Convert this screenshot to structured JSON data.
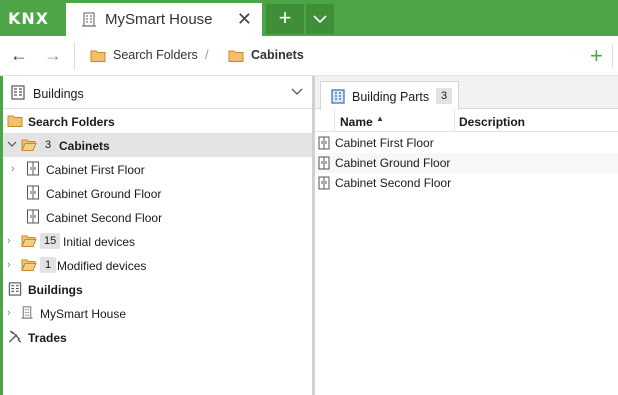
{
  "app": {
    "logo": "KNX",
    "tab_title": "MySmart House",
    "tab_close": "✕",
    "new_tab": "+"
  },
  "toolbar": {
    "back": "←",
    "forward": "→",
    "breadcrumbs": [
      "Search Folders",
      "Cabinets"
    ],
    "separator": "/",
    "add": "+"
  },
  "left_panel": {
    "header_label": "Buildings",
    "tree": [
      {
        "label": "Search Folders"
      },
      {
        "badge": "3",
        "label": "Cabinets"
      },
      {
        "label": "Cabinet First Floor"
      },
      {
        "label": "Cabinet Ground Floor"
      },
      {
        "label": "Cabinet Second Floor"
      },
      {
        "badge": "15",
        "label": "Initial devices"
      },
      {
        "badge": "1",
        "label": "Modified devices"
      },
      {
        "label": "Buildings"
      },
      {
        "label": "MySmart House"
      },
      {
        "label": "Trades"
      }
    ]
  },
  "right_panel": {
    "tab_label": "Building Parts",
    "tab_badge": "3",
    "columns": [
      "Name",
      "Description"
    ],
    "sort_indicator": "▲",
    "rows": [
      {
        "name": "Cabinet First Floor",
        "description": ""
      },
      {
        "name": "Cabinet Ground Floor",
        "description": ""
      },
      {
        "name": "Cabinet Second Floor",
        "description": ""
      }
    ]
  },
  "colors": {
    "accent": "#4ea547",
    "folder": "#e8a33c",
    "selected_row": "#e4e4e4"
  },
  "icons": {
    "building": "building-icon",
    "folder": "folder-icon",
    "cabinet": "cabinet-icon",
    "trades": "tools-icon"
  }
}
